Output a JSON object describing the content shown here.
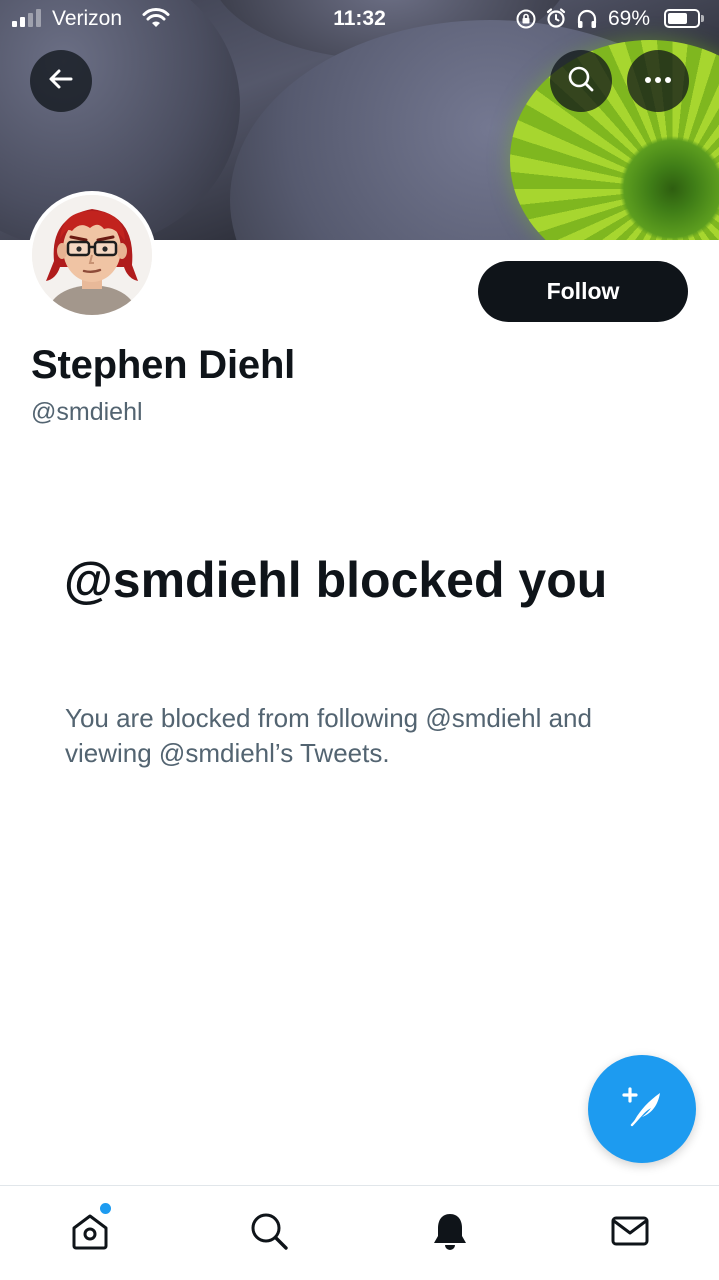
{
  "status_bar": {
    "carrier": "Verizon",
    "time": "11:32",
    "battery_percent": "69%",
    "battery_level": 0.69,
    "icons": [
      "signal-icon",
      "wifi-icon",
      "rotation-lock-icon",
      "alarm-icon",
      "headphones-icon",
      "battery-icon"
    ]
  },
  "header": {
    "back_icon": "arrow-left-icon",
    "search_icon": "search-icon",
    "more_icon": "more-horizontal-icon"
  },
  "profile": {
    "display_name": "Stephen Diehl",
    "handle": "@smdiehl",
    "follow_label": "Follow"
  },
  "blocked": {
    "title": "@smdiehl blocked you",
    "description": "You are blocked from following @smdiehl and viewing @smdiehl’s Tweets."
  },
  "fab": {
    "icon": "compose-tweet-icon"
  },
  "tab_bar": {
    "items": [
      {
        "name": "home",
        "icon": "home-icon",
        "has_notification_dot": true
      },
      {
        "name": "search",
        "icon": "search-icon"
      },
      {
        "name": "notifications",
        "icon": "bell-icon"
      },
      {
        "name": "messages",
        "icon": "mail-icon"
      }
    ]
  },
  "colors": {
    "accent": "#1d9bf0",
    "text_primary": "#0f1419",
    "text_secondary": "#536471"
  }
}
